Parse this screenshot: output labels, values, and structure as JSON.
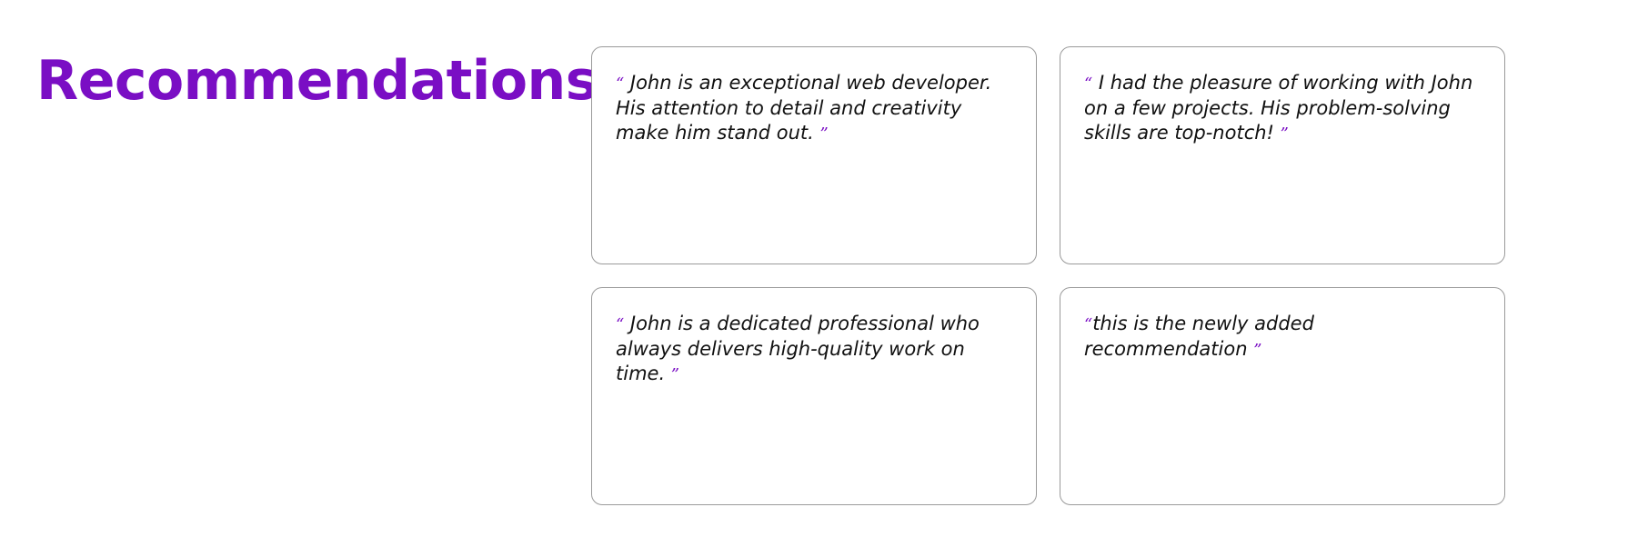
{
  "section": {
    "title": "Recommendations"
  },
  "colors": {
    "accent": "#7a0ec4",
    "text": "#111111",
    "border": "#9a9a9a",
    "background": "#ffffff"
  },
  "quote_marks": {
    "open": "“",
    "close": "”"
  },
  "recommendations": [
    {
      "text": " John is an exceptional web developer. His attention to detail and creativity make him stand out. "
    },
    {
      "text": " I had the pleasure of working with John on a few projects. His problem-solving skills are top-notch! "
    },
    {
      "text": " John is a dedicated professional who always delivers high-quality work on time. "
    },
    {
      "text": "this is the newly added recommendation "
    }
  ]
}
